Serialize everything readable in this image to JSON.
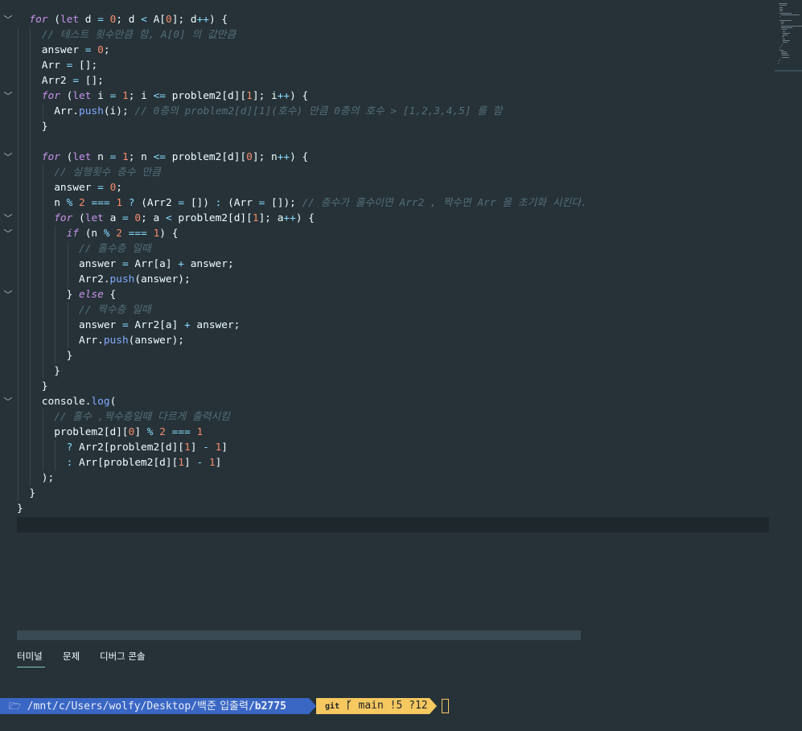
{
  "editor": {
    "lines": [
      [
        [
          "t-ital",
          "for"
        ],
        [
          "t-tx",
          " ("
        ],
        [
          "t-kw",
          "let"
        ],
        [
          "t-tx",
          " d "
        ],
        [
          "t-op",
          "="
        ],
        [
          "t-tx",
          " "
        ],
        [
          "t-num",
          "0"
        ],
        [
          "t-tx",
          "; d "
        ],
        [
          "t-op",
          "<"
        ],
        [
          "t-tx",
          " A["
        ],
        [
          "t-num",
          "0"
        ],
        [
          "t-tx",
          "]; d"
        ],
        [
          "t-op",
          "++"
        ],
        [
          "t-tx",
          ") {"
        ]
      ],
      [
        [
          "t-cm",
          "// 테스트 횟수만큼 함, A[0] 의 값만큼"
        ]
      ],
      [
        [
          "t-tx",
          "answer "
        ],
        [
          "t-op",
          "="
        ],
        [
          "t-tx",
          " "
        ],
        [
          "t-num",
          "0"
        ],
        [
          "t-tx",
          ";"
        ]
      ],
      [
        [
          "t-tx",
          "Arr "
        ],
        [
          "t-op",
          "="
        ],
        [
          "t-tx",
          " [];"
        ]
      ],
      [
        [
          "t-tx",
          "Arr2 "
        ],
        [
          "t-op",
          "="
        ],
        [
          "t-tx",
          " [];"
        ]
      ],
      [
        [
          "t-ital",
          "for"
        ],
        [
          "t-tx",
          " ("
        ],
        [
          "t-kw",
          "let"
        ],
        [
          "t-tx",
          " i "
        ],
        [
          "t-op",
          "="
        ],
        [
          "t-tx",
          " "
        ],
        [
          "t-num",
          "1"
        ],
        [
          "t-tx",
          "; i "
        ],
        [
          "t-op",
          "<="
        ],
        [
          "t-tx",
          " problem2[d]["
        ],
        [
          "t-num",
          "1"
        ],
        [
          "t-tx",
          "]; i"
        ],
        [
          "t-op",
          "++"
        ],
        [
          "t-tx",
          ") {"
        ]
      ],
      [
        [
          "t-tx",
          "Arr."
        ],
        [
          "t-fn",
          "push"
        ],
        [
          "t-tx",
          "(i); "
        ],
        [
          "t-cm",
          "// 0층의 problem2[d][1](호수) 만큼 0층의 호수 > [1,2,3,4,5] 를 함"
        ]
      ],
      [
        [
          "t-tx",
          "}"
        ]
      ],
      [],
      [
        [
          "t-ital",
          "for"
        ],
        [
          "t-tx",
          " ("
        ],
        [
          "t-kw",
          "let"
        ],
        [
          "t-tx",
          " n "
        ],
        [
          "t-op",
          "="
        ],
        [
          "t-tx",
          " "
        ],
        [
          "t-num",
          "1"
        ],
        [
          "t-tx",
          "; n "
        ],
        [
          "t-op",
          "<="
        ],
        [
          "t-tx",
          " problem2[d]["
        ],
        [
          "t-num",
          "0"
        ],
        [
          "t-tx",
          "]; n"
        ],
        [
          "t-op",
          "++"
        ],
        [
          "t-tx",
          ") {"
        ]
      ],
      [
        [
          "t-cm",
          "// 실행횟수 층수 만큼"
        ]
      ],
      [
        [
          "t-tx",
          "answer "
        ],
        [
          "t-op",
          "="
        ],
        [
          "t-tx",
          " "
        ],
        [
          "t-num",
          "0"
        ],
        [
          "t-tx",
          ";"
        ]
      ],
      [
        [
          "t-tx",
          "n "
        ],
        [
          "t-op",
          "%"
        ],
        [
          "t-tx",
          " "
        ],
        [
          "t-num",
          "2"
        ],
        [
          "t-tx",
          " "
        ],
        [
          "t-op",
          "==="
        ],
        [
          "t-tx",
          " "
        ],
        [
          "t-num",
          "1"
        ],
        [
          "t-tx",
          " "
        ],
        [
          "t-op",
          "?"
        ],
        [
          "t-tx",
          " (Arr2 "
        ],
        [
          "t-op",
          "="
        ],
        [
          "t-tx",
          " []) "
        ],
        [
          "t-op",
          ":"
        ],
        [
          "t-tx",
          " (Arr "
        ],
        [
          "t-op",
          "="
        ],
        [
          "t-tx",
          " []); "
        ],
        [
          "t-cm",
          "// 층수가 홀수이면 Arr2 , 짝수면 Arr 을 초기화 시킨다."
        ]
      ],
      [
        [
          "t-ital",
          "for"
        ],
        [
          "t-tx",
          " ("
        ],
        [
          "t-kw",
          "let"
        ],
        [
          "t-tx",
          " a "
        ],
        [
          "t-op",
          "="
        ],
        [
          "t-tx",
          " "
        ],
        [
          "t-num",
          "0"
        ],
        [
          "t-tx",
          "; a "
        ],
        [
          "t-op",
          "<"
        ],
        [
          "t-tx",
          " problem2[d]["
        ],
        [
          "t-num",
          "1"
        ],
        [
          "t-tx",
          "]; a"
        ],
        [
          "t-op",
          "++"
        ],
        [
          "t-tx",
          ") {"
        ]
      ],
      [
        [
          "t-ital",
          "if"
        ],
        [
          "t-tx",
          " (n "
        ],
        [
          "t-op",
          "%"
        ],
        [
          "t-tx",
          " "
        ],
        [
          "t-num",
          "2"
        ],
        [
          "t-tx",
          " "
        ],
        [
          "t-op",
          "==="
        ],
        [
          "t-tx",
          " "
        ],
        [
          "t-num",
          "1"
        ],
        [
          "t-tx",
          ") {"
        ]
      ],
      [
        [
          "t-cm",
          "// 홀수층 일때"
        ]
      ],
      [
        [
          "t-tx",
          "answer "
        ],
        [
          "t-op",
          "="
        ],
        [
          "t-tx",
          " Arr[a] "
        ],
        [
          "t-op",
          "+"
        ],
        [
          "t-tx",
          " answer;"
        ]
      ],
      [
        [
          "t-tx",
          "Arr2."
        ],
        [
          "t-fn",
          "push"
        ],
        [
          "t-tx",
          "(answer);"
        ]
      ],
      [
        [
          "t-tx",
          "} "
        ],
        [
          "t-ital",
          "else"
        ],
        [
          "t-tx",
          " {"
        ]
      ],
      [
        [
          "t-cm",
          "// 짝수층 일때"
        ]
      ],
      [
        [
          "t-tx",
          "answer "
        ],
        [
          "t-op",
          "="
        ],
        [
          "t-tx",
          " Arr2[a] "
        ],
        [
          "t-op",
          "+"
        ],
        [
          "t-tx",
          " answer;"
        ]
      ],
      [
        [
          "t-tx",
          "Arr."
        ],
        [
          "t-fn",
          "push"
        ],
        [
          "t-tx",
          "(answer);"
        ]
      ],
      [
        [
          "t-tx",
          "}"
        ]
      ],
      [
        [
          "t-tx",
          "}"
        ]
      ],
      [
        [
          "t-tx",
          "}"
        ]
      ],
      [
        [
          "t-tx",
          "console."
        ],
        [
          "t-fn",
          "log"
        ],
        [
          "t-tx",
          "("
        ]
      ],
      [
        [
          "t-cm",
          "// 홀수 ,짝수층일때 다르게 출력시킴"
        ]
      ],
      [
        [
          "t-tx",
          "problem2[d]["
        ],
        [
          "t-num",
          "0"
        ],
        [
          "t-tx",
          "] "
        ],
        [
          "t-op",
          "%"
        ],
        [
          "t-tx",
          " "
        ],
        [
          "t-num",
          "2"
        ],
        [
          "t-tx",
          " "
        ],
        [
          "t-op",
          "==="
        ],
        [
          "t-tx",
          " "
        ],
        [
          "t-num",
          "1"
        ]
      ],
      [
        [
          "t-op",
          "?"
        ],
        [
          "t-tx",
          " Arr2[problem2[d]["
        ],
        [
          "t-num",
          "1"
        ],
        [
          "t-tx",
          "] "
        ],
        [
          "t-op",
          "-"
        ],
        [
          "t-tx",
          " "
        ],
        [
          "t-num",
          "1"
        ],
        [
          "t-tx",
          "]"
        ]
      ],
      [
        [
          "t-op",
          ":"
        ],
        [
          "t-tx",
          " Arr[problem2[d]["
        ],
        [
          "t-num",
          "1"
        ],
        [
          "t-tx",
          "] "
        ],
        [
          "t-op",
          "-"
        ],
        [
          "t-tx",
          " "
        ],
        [
          "t-num",
          "1"
        ],
        [
          "t-tx",
          "]"
        ]
      ],
      [
        [
          "t-tx",
          ");"
        ]
      ],
      [
        [
          "t-tx",
          "}"
        ]
      ],
      [
        [
          "t-tx",
          "}"
        ]
      ]
    ]
  },
  "panel": {
    "tabs": [
      "터미널",
      "문제",
      "디버그 콘솔"
    ]
  },
  "terminal": {
    "folder_icon": "🗁",
    "path_before": " /mnt/c/Users/wolfy/Desktop/",
    "path_highlight": "백준 입출력",
    "path_after": "/b2775",
    "git_label": "git",
    "branch_icon": "ᚴ",
    "branch": "main !5 ?12"
  },
  "colors": {
    "editor_bg": "#263238",
    "path_segment": "#3a66c4",
    "git_segment": "#f6c860"
  },
  "icons": [
    "fold-chevron-icon",
    "folder-icon",
    "git-branch-icon"
  ]
}
